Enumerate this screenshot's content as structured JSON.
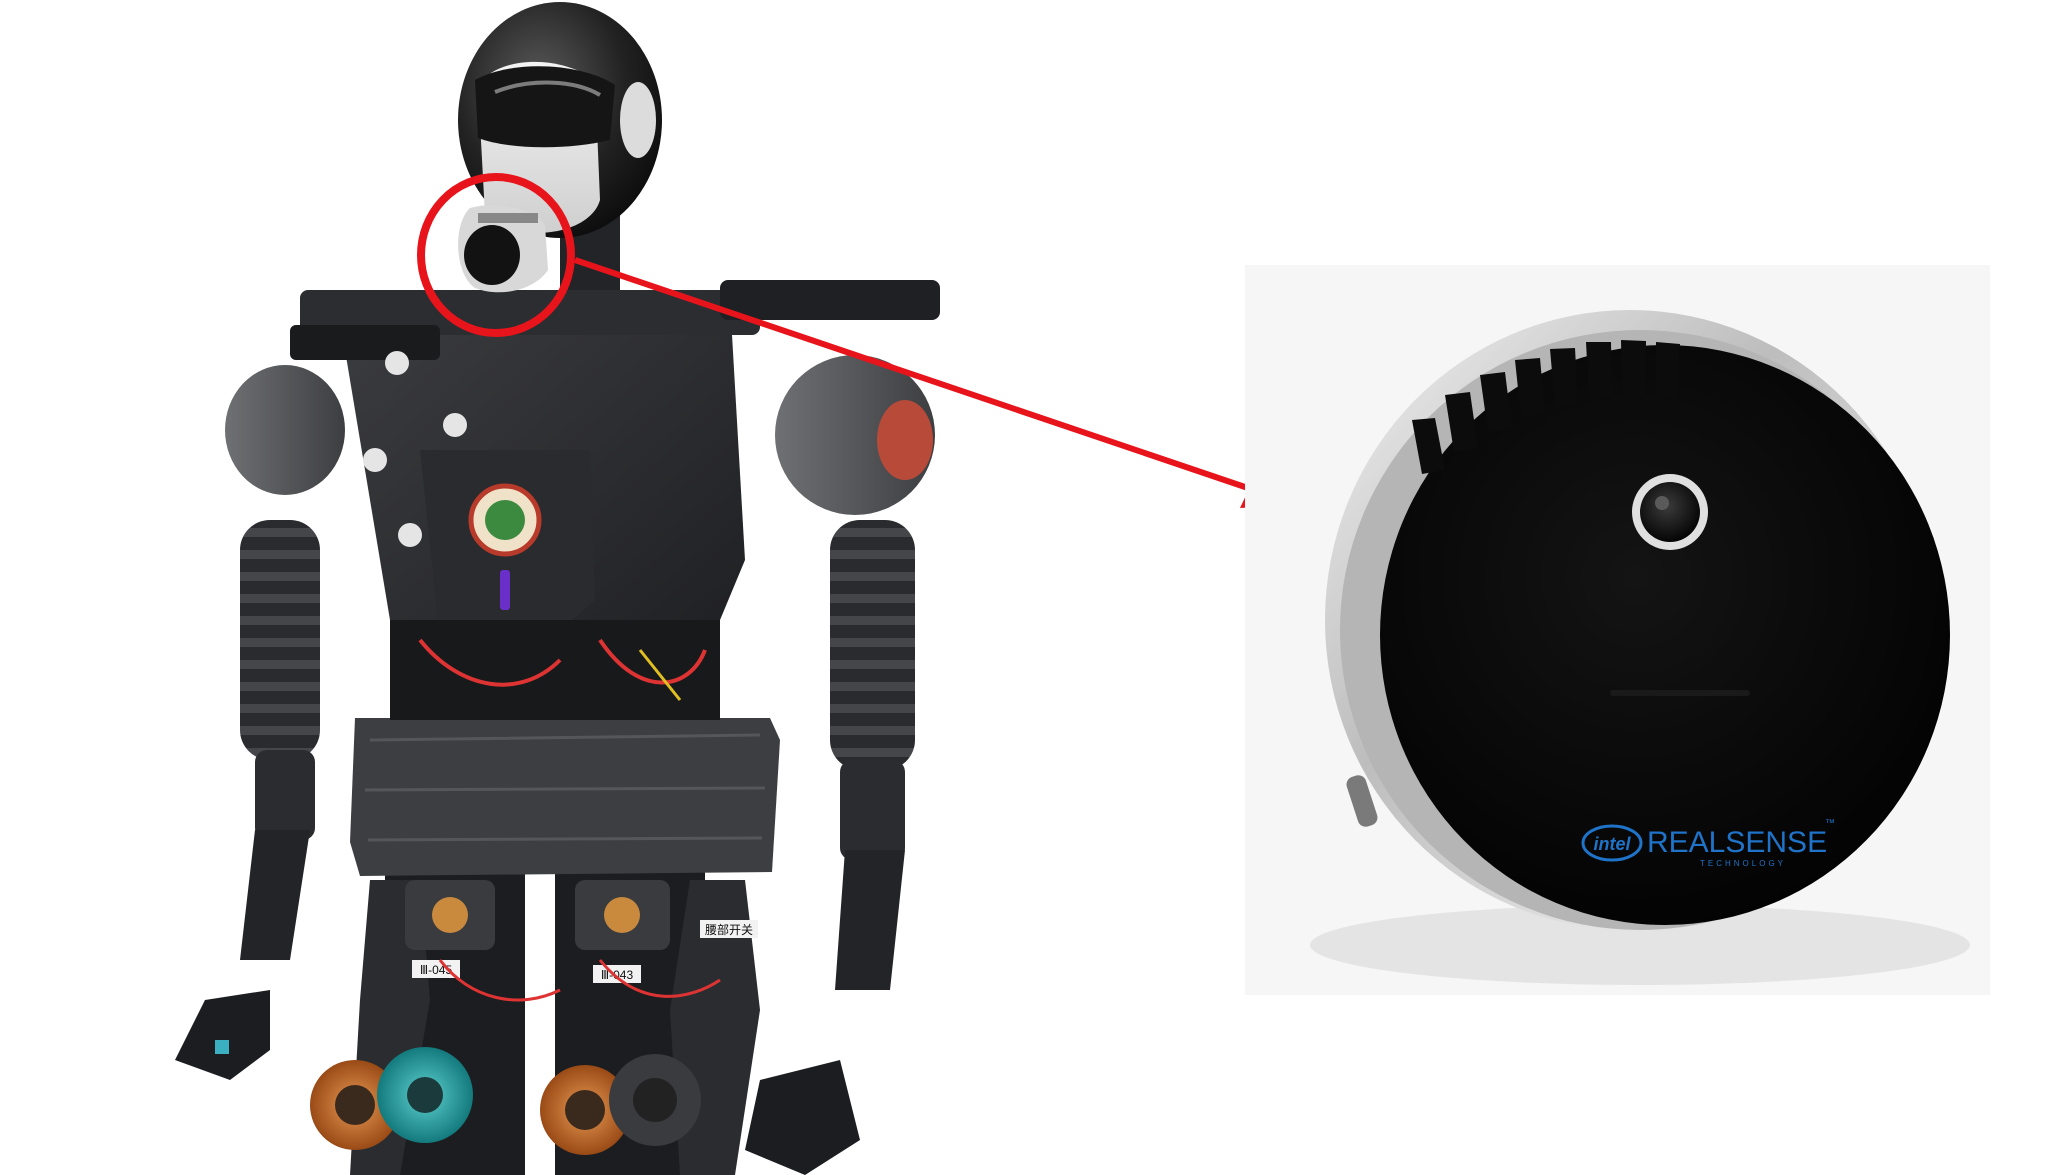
{
  "figure": {
    "left_photo": "humanoid-robot",
    "right_photo": "intel-realsense-camera",
    "highlight_color": "#e8141b",
    "arrow_color": "#e8141b"
  },
  "camera": {
    "brand_logo": "intel",
    "brand_name": "REALSENSE",
    "brand_mark": "™",
    "brand_sub": "TECHNOLOGY",
    "logo_color": "#1f73c9"
  },
  "robot": {
    "leg_labels": [
      "Ⅲ-045",
      "Ⅲ-043",
      "腰部开关"
    ]
  }
}
